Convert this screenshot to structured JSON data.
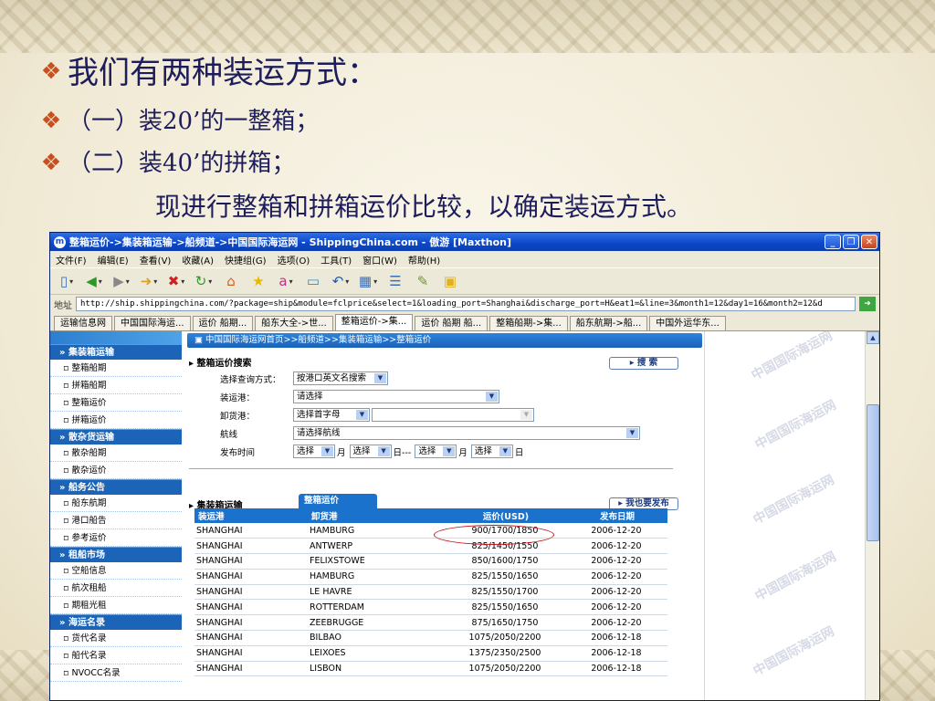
{
  "slide": {
    "bullets": {
      "main": "我们有两种装运方式：",
      "option1": "（一）装20’的一整箱；",
      "option2": "（二）装40’的拼箱；",
      "comparison": "现进行整箱和拼箱运价比较，以确定装运方式。"
    }
  },
  "browser": {
    "title": "整箱运价->集装箱运输->船频道->中国国际海运网 - ShippingChina.com - 傲游 [Maxthon]",
    "menu": [
      "文件(F)",
      "编辑(E)",
      "查看(V)",
      "收藏(A)",
      "快捷组(G)",
      "选项(O)",
      "工具(T)",
      "窗口(W)",
      "帮助(H)"
    ],
    "address_label": "地址",
    "url": "http://ship.shippingchina.com/?package=ship&module=fclprice&select=1&loading_port=Shanghai&discharge_port=H&eat1=&line=3&month1=12&day1=16&month2=12&d",
    "tabs": [
      "运输信息网",
      "中国国际海运...",
      "运价 船期...",
      "船东大全->世...",
      "整箱运价->集...",
      "运价 船期 船...",
      "整箱船期->集...",
      "船东航期->船...",
      "中国外运华东..."
    ]
  },
  "sidebar": {
    "sections": [
      {
        "title": "» 集装箱运输",
        "items": [
          "整箱船期",
          "拼箱船期",
          "整箱运价",
          "拼箱运价"
        ]
      },
      {
        "title": "» 散杂货运输",
        "items": [
          "散杂船期",
          "散杂运价"
        ]
      },
      {
        "title": "» 船务公告",
        "items": [
          "船东航期",
          "港口船告",
          "参考运价"
        ]
      },
      {
        "title": "» 租船市场",
        "items": [
          "空船信息",
          "航次租船",
          "期租光租"
        ]
      },
      {
        "title": "» 海运名录",
        "items": [
          "货代名录",
          "船代名录",
          "NVOCC名录"
        ]
      }
    ]
  },
  "main": {
    "breadcrumb": "中国国际海运网首页>>船频道>>集装箱运输>>整箱运价",
    "search": {
      "title": "整箱运价搜索",
      "search_button": "搜 索",
      "method_label": "选择查询方式：",
      "method_value": "按港口英文名搜索",
      "loading_label": "装运港：",
      "loading_value": "请选择",
      "discharge_label": "卸货港：",
      "discharge_value": "选择首字母",
      "route_label": "航线",
      "route_value": "请选择航线",
      "date_label": "发布时间",
      "date_select": "选择",
      "unit_month": "月",
      "unit_day": "日",
      "unit_day_range": "日---"
    },
    "results": {
      "title": "集装箱运输",
      "subtab": "整箱运价",
      "publish_button": "我也要发布",
      "columns": [
        "装运港",
        "卸货港",
        "运价(USD)",
        "发布日期"
      ],
      "rows": [
        [
          "SHANGHAI",
          "HAMBURG",
          "900/1700/1850",
          "2006-12-20"
        ],
        [
          "SHANGHAI",
          "ANTWERP",
          "825/1450/1550",
          "2006-12-20"
        ],
        [
          "SHANGHAI",
          "FELIXSTOWE",
          "850/1600/1750",
          "2006-12-20"
        ],
        [
          "SHANGHAI",
          "HAMBURG",
          "825/1550/1650",
          "2006-12-20"
        ],
        [
          "SHANGHAI",
          "LE HAVRE",
          "825/1550/1700",
          "2006-12-20"
        ],
        [
          "SHANGHAI",
          "ROTTERDAM",
          "825/1550/1650",
          "2006-12-20"
        ],
        [
          "SHANGHAI",
          "ZEEBRUGGE",
          "875/1650/1750",
          "2006-12-20"
        ],
        [
          "SHANGHAI",
          "BILBAO",
          "1075/2050/2200",
          "2006-12-18"
        ],
        [
          "SHANGHAI",
          "LEIXOES",
          "1375/2350/2500",
          "2006-12-18"
        ],
        [
          "SHANGHAI",
          "LISBON",
          "1075/2050/2200",
          "2006-12-18"
        ]
      ]
    }
  },
  "watermark": "中国国际海运网",
  "colors": {
    "accent": "#1a72cc",
    "highlight": "#c0141c",
    "bullet": "#c94f1e",
    "slide_text": "#1d1d5c"
  }
}
